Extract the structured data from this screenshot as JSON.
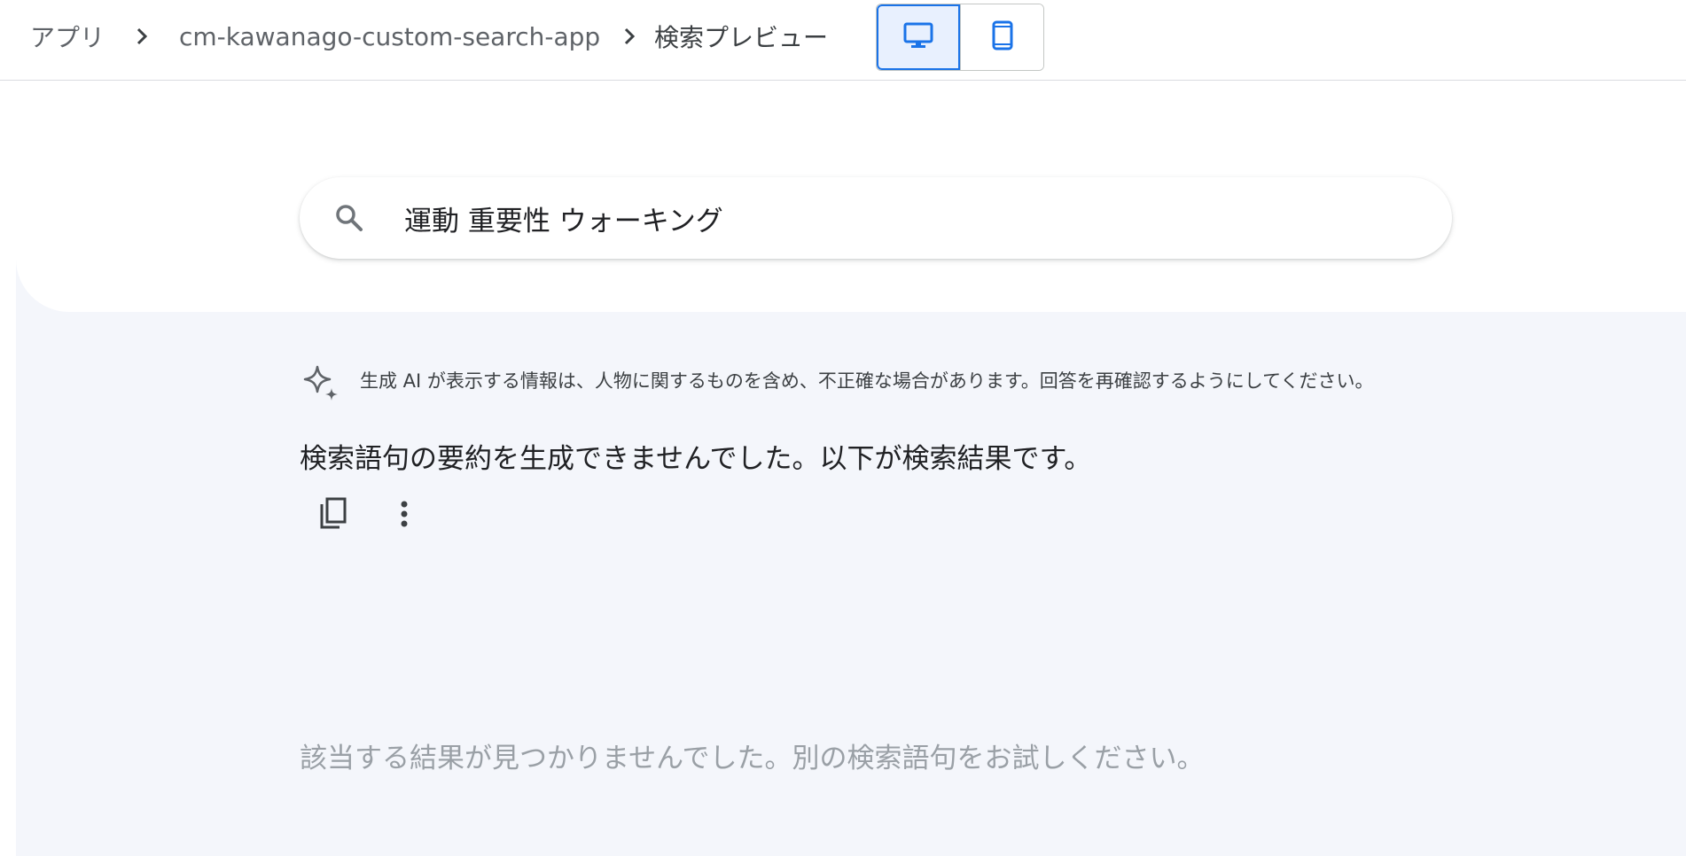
{
  "breadcrumb": {
    "items": [
      "アプリ",
      "cm-kawanago-custom-search-app",
      "検索プレビュー"
    ]
  },
  "view_toggle": {
    "desktop_icon": "desktop-icon",
    "mobile_icon": "mobile-icon",
    "selected": "desktop"
  },
  "search": {
    "query": "運動 重要性 ウォーキング",
    "icon": "search-icon"
  },
  "ai_notice": {
    "icon": "sparkle-icon",
    "text": "生成 AI が表示する情報は、人物に関するものを含め、不正確な場合があります。回答を再確認するようにしてください。"
  },
  "summary": {
    "text": "検索語句の要約を生成できませんでした。以下が検索結果です。",
    "copy_icon": "copy-icon",
    "more_icon": "more-vert-icon"
  },
  "results": {
    "empty_text": "該当する結果が見つかりませんでした。別の検索語句をお試しください。"
  },
  "colors": {
    "accent": "#1a73e8",
    "background": "#f4f6fb",
    "muted_text": "#9aa0a6"
  }
}
